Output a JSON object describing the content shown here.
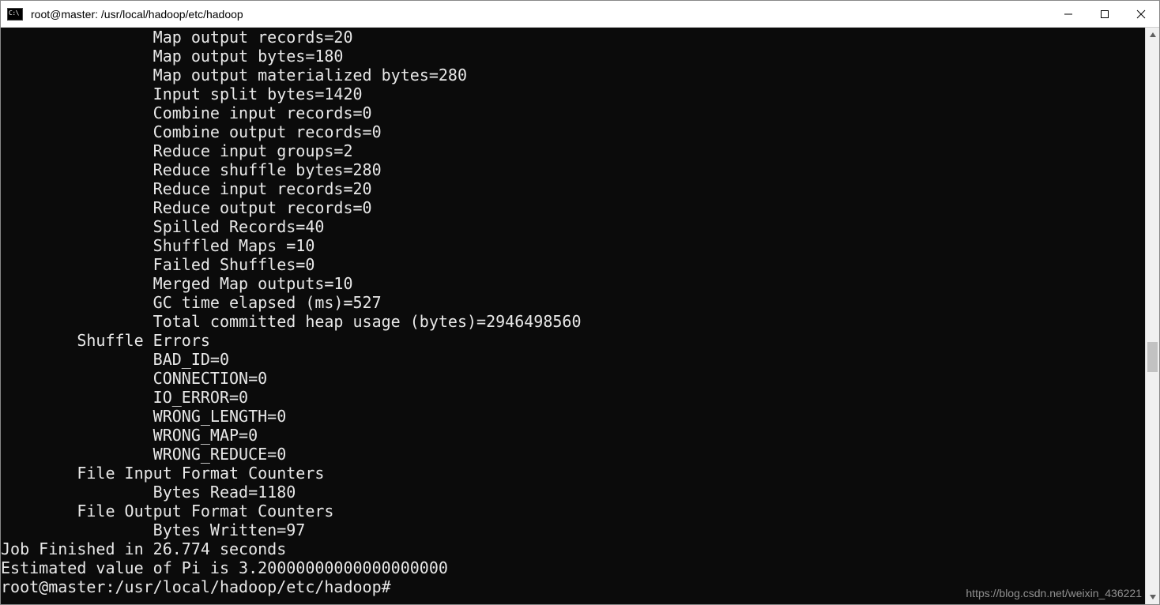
{
  "window": {
    "title": "root@master: /usr/local/hadoop/etc/hadoop"
  },
  "terminal": {
    "lines": [
      "                Map output records=20",
      "                Map output bytes=180",
      "                Map output materialized bytes=280",
      "                Input split bytes=1420",
      "                Combine input records=0",
      "                Combine output records=0",
      "                Reduce input groups=2",
      "                Reduce shuffle bytes=280",
      "                Reduce input records=20",
      "                Reduce output records=0",
      "                Spilled Records=40",
      "                Shuffled Maps =10",
      "                Failed Shuffles=0",
      "                Merged Map outputs=10",
      "                GC time elapsed (ms)=527",
      "                Total committed heap usage (bytes)=2946498560",
      "        Shuffle Errors",
      "                BAD_ID=0",
      "                CONNECTION=0",
      "                IO_ERROR=0",
      "                WRONG_LENGTH=0",
      "                WRONG_MAP=0",
      "                WRONG_REDUCE=0",
      "        File Input Format Counters",
      "                Bytes Read=1180",
      "        File Output Format Counters",
      "                Bytes Written=97",
      "Job Finished in 26.774 seconds",
      "Estimated value of Pi is 3.20000000000000000000"
    ],
    "prompt": "root@master:/usr/local/hadoop/etc/hadoop#"
  },
  "watermark": "https://blog.csdn.net/weixin_436221"
}
